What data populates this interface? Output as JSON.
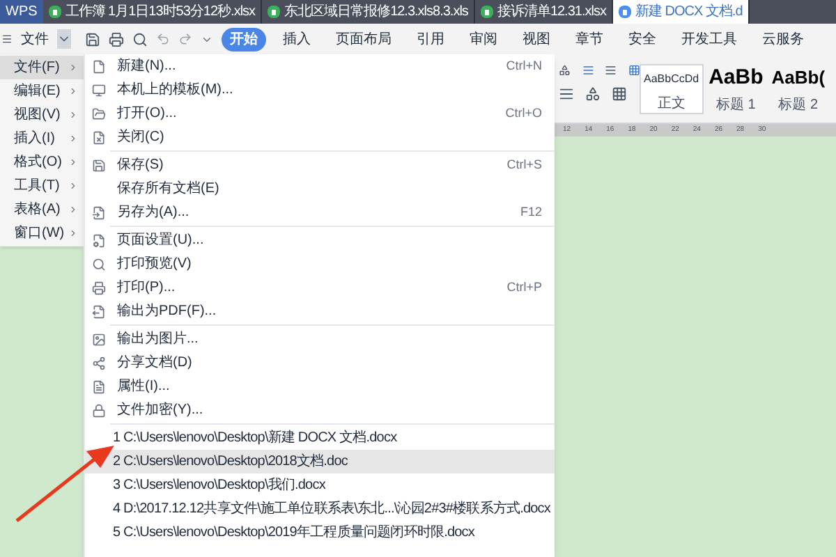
{
  "window_tabs": [
    {
      "label": "WPS",
      "kind": "logo",
      "selected": false
    },
    {
      "label": "工作簿 1月1日13时53分12秒.xlsx",
      "kind": "sheet",
      "selected": false
    },
    {
      "label": "东北区域日常报修12.3.xls8.3.xls",
      "kind": "sheet",
      "selected": false
    },
    {
      "label": "接诉清单12.31.xlsx",
      "kind": "sheet",
      "selected": false
    },
    {
      "label": "新建 DOCX 文档.d",
      "kind": "doc",
      "selected": true
    }
  ],
  "toolbar": {
    "file_menu": "文件"
  },
  "ribbon_tabs": [
    {
      "label": "开始",
      "selected": true
    },
    {
      "label": "插入",
      "selected": false
    },
    {
      "label": "页面布局",
      "selected": false
    },
    {
      "label": "引用",
      "selected": false
    },
    {
      "label": "审阅",
      "selected": false
    },
    {
      "label": "视图",
      "selected": false
    },
    {
      "label": "章节",
      "selected": false
    },
    {
      "label": "安全",
      "selected": false
    },
    {
      "label": "开发工具",
      "selected": false
    },
    {
      "label": "云服务",
      "selected": false
    }
  ],
  "styles": [
    {
      "sample": "AaBbCcDd",
      "name": "正文",
      "kind": "normal"
    },
    {
      "sample": "AaBb",
      "name": "标题 1",
      "kind": "h1"
    },
    {
      "sample": "AaBb(",
      "name": "标题 2",
      "kind": "h2"
    }
  ],
  "ruler": [
    "12",
    "14",
    "16",
    "18",
    "20",
    "22",
    "24",
    "26",
    "28",
    "30"
  ],
  "main_menu": [
    {
      "label": "文件(F)",
      "selected": true
    },
    {
      "label": "编辑(E)",
      "selected": false
    },
    {
      "label": "视图(V)",
      "selected": false
    },
    {
      "label": "插入(I)",
      "selected": false
    },
    {
      "label": "格式(O)",
      "selected": false
    },
    {
      "label": "工具(T)",
      "selected": false
    },
    {
      "label": "表格(A)",
      "selected": false
    },
    {
      "label": "窗口(W)",
      "selected": false
    }
  ],
  "file_menu": [
    {
      "kind": "item",
      "label": "新建(N)...",
      "shortcut": "Ctrl+N"
    },
    {
      "kind": "item",
      "label": "本机上的模板(M)..."
    },
    {
      "kind": "item",
      "label": "打开(O)...",
      "shortcut": "Ctrl+O"
    },
    {
      "kind": "item",
      "label": "关闭(C)"
    },
    {
      "kind": "separator"
    },
    {
      "kind": "item",
      "label": "保存(S)",
      "shortcut": "Ctrl+S"
    },
    {
      "kind": "item",
      "label": "保存所有文档(E)"
    },
    {
      "kind": "item",
      "label": "另存为(A)...",
      "shortcut": "F12"
    },
    {
      "kind": "separator"
    },
    {
      "kind": "item",
      "label": "页面设置(U)..."
    },
    {
      "kind": "item",
      "label": "打印预览(V)"
    },
    {
      "kind": "item",
      "label": "打印(P)...",
      "shortcut": "Ctrl+P"
    },
    {
      "kind": "item",
      "label": "输出为PDF(F)..."
    },
    {
      "kind": "separator"
    },
    {
      "kind": "item",
      "label": "输出为图片..."
    },
    {
      "kind": "item",
      "label": "分享文档(D)"
    },
    {
      "kind": "item",
      "label": "属性(I)..."
    },
    {
      "kind": "item",
      "label": "文件加密(Y)..."
    },
    {
      "kind": "separator"
    }
  ],
  "recent_files": [
    {
      "label": "1 C:\\Users\\lenovo\\Desktop\\新建 DOCX 文档.docx",
      "selected": false
    },
    {
      "label": "2 C:\\Users\\lenovo\\Desktop\\2018文档.doc",
      "selected": true
    },
    {
      "label": "3 C:\\Users\\lenovo\\Desktop\\我们.docx",
      "selected": false
    },
    {
      "label": "4 D:\\2017.12.12共享文件\\施工单位联系表\\东北...\\沁园2#3#楼联系方式.docx",
      "selected": false
    },
    {
      "label": "5 C:\\Users\\lenovo\\Desktop\\2019年工程质量问题闭环时限.docx",
      "selected": false
    }
  ]
}
